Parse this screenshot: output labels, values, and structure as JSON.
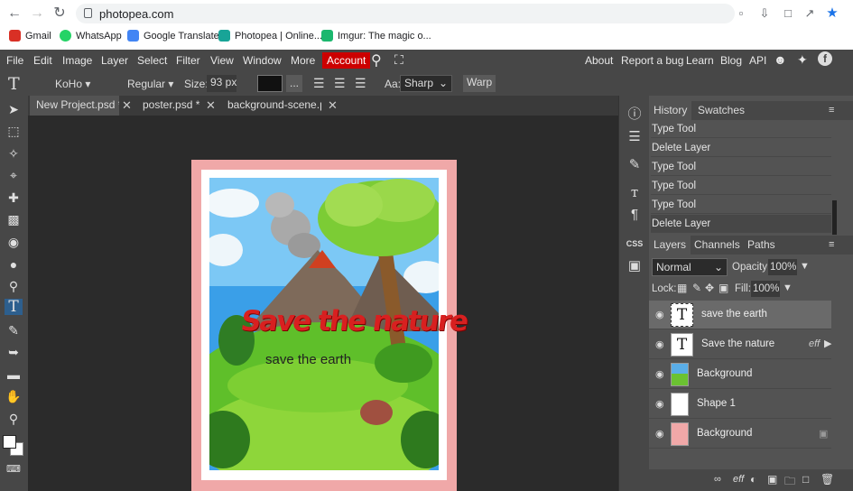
{
  "browser": {
    "url": "photopea.com",
    "bookmarks": [
      {
        "label": "Gmail",
        "color": "#d93025"
      },
      {
        "label": "WhatsApp",
        "color": "#25d366"
      },
      {
        "label": "Google Translate",
        "color": "#4285f4"
      },
      {
        "label": "Photopea | Online...",
        "color": "#18a497"
      },
      {
        "label": "Imgur: The magic o...",
        "color": "#1bb76e"
      }
    ]
  },
  "menu": {
    "items": [
      "File",
      "Edit",
      "Image",
      "Layer",
      "Select",
      "Filter",
      "View",
      "Window",
      "More"
    ],
    "account": "Account",
    "right_links": [
      "About",
      "Report a bug",
      "Learn",
      "Blog",
      "API"
    ]
  },
  "options": {
    "font": "KoHo",
    "style": "Regular",
    "size_label": "Size:",
    "size_value": "93 px",
    "more": "...",
    "aa_label": "Aa:",
    "aa_value": "Sharp",
    "warp": "Warp"
  },
  "tabs": [
    {
      "label": "New Project.psd *",
      "active": true
    },
    {
      "label": "poster.psd *",
      "active": false
    },
    {
      "label": "background-scene.psd",
      "active": false
    }
  ],
  "poster": {
    "title": "Save the nature",
    "subtitle": "save the earth",
    "border_color": "#f0a8a8"
  },
  "history": {
    "tabs": [
      "History",
      "Swatches"
    ],
    "items": [
      "Type Tool",
      "Delete Layer",
      "Type Tool",
      "Type Tool",
      "Type Tool",
      "Delete Layer"
    ]
  },
  "layers_panel": {
    "tabs": [
      "Layers",
      "Channels",
      "Paths"
    ],
    "blend_mode": "Normal",
    "opacity_label": "Opacity:",
    "opacity": "100%",
    "lock_label": "Lock:",
    "fill_label": "Fill:",
    "fill": "100%",
    "layers": [
      {
        "name": "save the earth",
        "type": "text",
        "selected": true
      },
      {
        "name": "Save the nature",
        "type": "text",
        "selected": false,
        "effects": "eff"
      },
      {
        "name": "Background",
        "type": "image",
        "selected": false
      },
      {
        "name": "Shape 1",
        "type": "shape",
        "selected": false
      },
      {
        "name": "Background",
        "type": "fill",
        "selected": false,
        "locked": true
      }
    ]
  },
  "icons": {
    "toolbar": [
      "type-tool-icon",
      "move-icon",
      "marquee-icon",
      "magic-wand-icon",
      "crop-icon",
      "healing-icon",
      "stamp-icon",
      "eraser-icon",
      "blur-icon",
      "dodge-icon",
      "text-icon",
      "pen-icon",
      "path-select-icon",
      "shape-icon",
      "hand-icon",
      "zoom-icon"
    ],
    "type_glyph": "T",
    "t_glyph": "T"
  }
}
